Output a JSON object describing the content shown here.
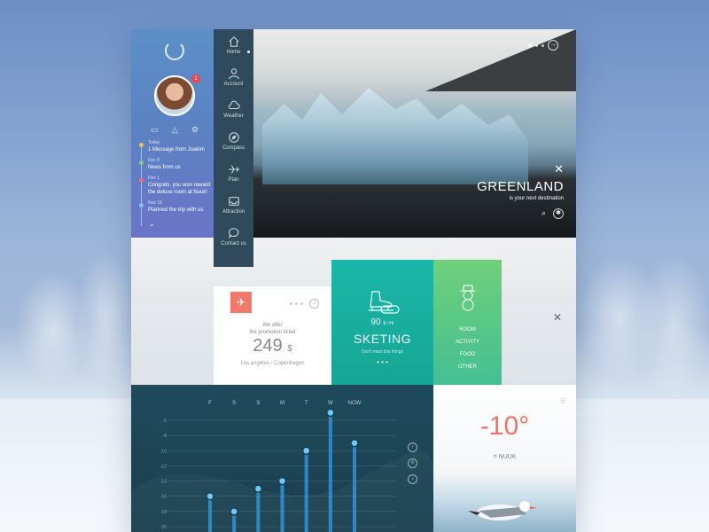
{
  "profile": {
    "notifications_badge": "1",
    "timeline": [
      {
        "date": "Today",
        "text": "1 Message from Joakim",
        "color": "#f5c34c"
      },
      {
        "date": "Dec 8",
        "text": "News from us",
        "color": "#7ed07a"
      },
      {
        "date": "Dec 1",
        "text": "Congrats, you won reward the deluxe room at Nuuk!",
        "color": "#ef6f7a"
      },
      {
        "date": "Nov 18",
        "text": "Planned the trip with us",
        "color": "#7ec9e8"
      }
    ]
  },
  "nav": {
    "items": [
      {
        "label": "Home",
        "icon": "home-icon"
      },
      {
        "label": "Account",
        "icon": "user-icon"
      },
      {
        "label": "Weather",
        "icon": "cloud-icon"
      },
      {
        "label": "Compass",
        "icon": "compass-icon"
      },
      {
        "label": "Plan",
        "icon": "plane-icon"
      },
      {
        "label": "Attraction",
        "icon": "inbox-icon"
      },
      {
        "label": "Contact us",
        "icon": "chat-icon"
      }
    ]
  },
  "hero": {
    "title": "GREENLAND",
    "subtitle": "is your next destination",
    "close": "✕",
    "next": "→"
  },
  "ticket": {
    "offer_line1": "We offer",
    "offer_line2": "the promotion ticket",
    "price": "249",
    "currency": "$",
    "route": "Los angeles  ›  Copenhagen"
  },
  "skating": {
    "rate": "90",
    "rate_unit": "$ / Hr",
    "title": "SKETING",
    "subtitle": "Don't miss this things",
    "more": "• • •"
  },
  "extras": {
    "menu": [
      "ROOM",
      "ACTIVITY",
      "FOOD",
      "OTHER"
    ]
  },
  "middle": {
    "close": "✕"
  },
  "chart_data": {
    "type": "line",
    "categories": [
      "F",
      "S",
      "S",
      "M",
      "T",
      "W",
      "NOW"
    ],
    "x_axis": [
      "F",
      "S",
      "S",
      "M",
      "T",
      "W",
      "NOW"
    ],
    "values": [
      -16,
      -18,
      -15,
      -14,
      -10,
      -5,
      -9
    ],
    "y_ticks": [
      "-6",
      "-8",
      "-10",
      "-12",
      "-14",
      "-16",
      "-18",
      "-20"
    ],
    "ylim": [
      -20,
      -6
    ]
  },
  "weather": {
    "temperature": "-10",
    "degree": "°",
    "location": "NUUK",
    "accent": "#ef7466"
  }
}
